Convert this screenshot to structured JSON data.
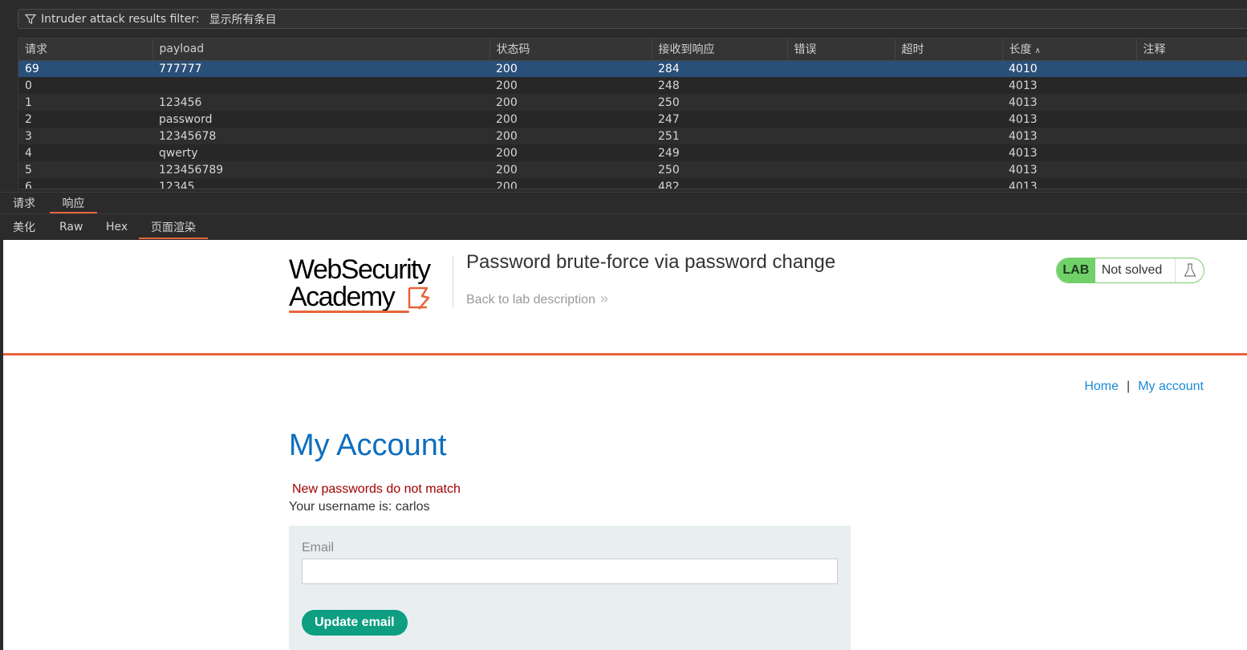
{
  "filter": {
    "label": "Intruder attack results filter:",
    "value": "显示所有条目"
  },
  "table": {
    "columns": [
      "请求",
      "payload",
      "状态码",
      "接收到响应",
      "错误",
      "超时",
      "长度",
      "注释"
    ],
    "sorted_column": "长度",
    "rows": [
      {
        "req": "69",
        "payload": "777777",
        "status": "200",
        "resp": "284",
        "error": "",
        "timeout": "",
        "length": "4010",
        "comment": "",
        "selected": true
      },
      {
        "req": "0",
        "payload": "",
        "status": "200",
        "resp": "248",
        "error": "",
        "timeout": "",
        "length": "4013",
        "comment": ""
      },
      {
        "req": "1",
        "payload": "123456",
        "status": "200",
        "resp": "250",
        "error": "",
        "timeout": "",
        "length": "4013",
        "comment": ""
      },
      {
        "req": "2",
        "payload": "password",
        "status": "200",
        "resp": "247",
        "error": "",
        "timeout": "",
        "length": "4013",
        "comment": ""
      },
      {
        "req": "3",
        "payload": "12345678",
        "status": "200",
        "resp": "251",
        "error": "",
        "timeout": "",
        "length": "4013",
        "comment": ""
      },
      {
        "req": "4",
        "payload": "qwerty",
        "status": "200",
        "resp": "249",
        "error": "",
        "timeout": "",
        "length": "4013",
        "comment": ""
      },
      {
        "req": "5",
        "payload": "123456789",
        "status": "200",
        "resp": "250",
        "error": "",
        "timeout": "",
        "length": "4013",
        "comment": ""
      },
      {
        "req": "6",
        "payload": "12345",
        "status": "200",
        "resp": "482",
        "error": "",
        "timeout": "",
        "length": "4013",
        "comment": ""
      }
    ]
  },
  "message_tabs": [
    "请求",
    "响应"
  ],
  "message_tab_active": "响应",
  "view_tabs": [
    "美化",
    "Raw",
    "Hex",
    "页面渲染"
  ],
  "view_tab_active": "页面渲染",
  "page": {
    "logo_line1": "WebSecurity",
    "logo_line2": "Academy",
    "lab_title": "Password brute-force via password change",
    "back_link": "Back to lab description",
    "lab_badge": "LAB",
    "lab_status": "Not solved",
    "nav_home": "Home",
    "nav_separator": "|",
    "nav_account": "My account",
    "heading": "My Account",
    "error": "New passwords do not match",
    "username_line": "Your username is: carlos",
    "email_label": "Email",
    "email_value": "",
    "update_button": "Update email"
  },
  "colors": {
    "accent_orange": "#e8643a",
    "selected_row": "#2a4f78",
    "heading_blue": "#0d6ebd",
    "button_green": "#0e9e81",
    "lab_green": "#70d168",
    "error_red": "#a00000"
  },
  "icons": [
    "filter-icon",
    "sort-up-icon",
    "chevron-double-right-icon",
    "flask-icon"
  ]
}
